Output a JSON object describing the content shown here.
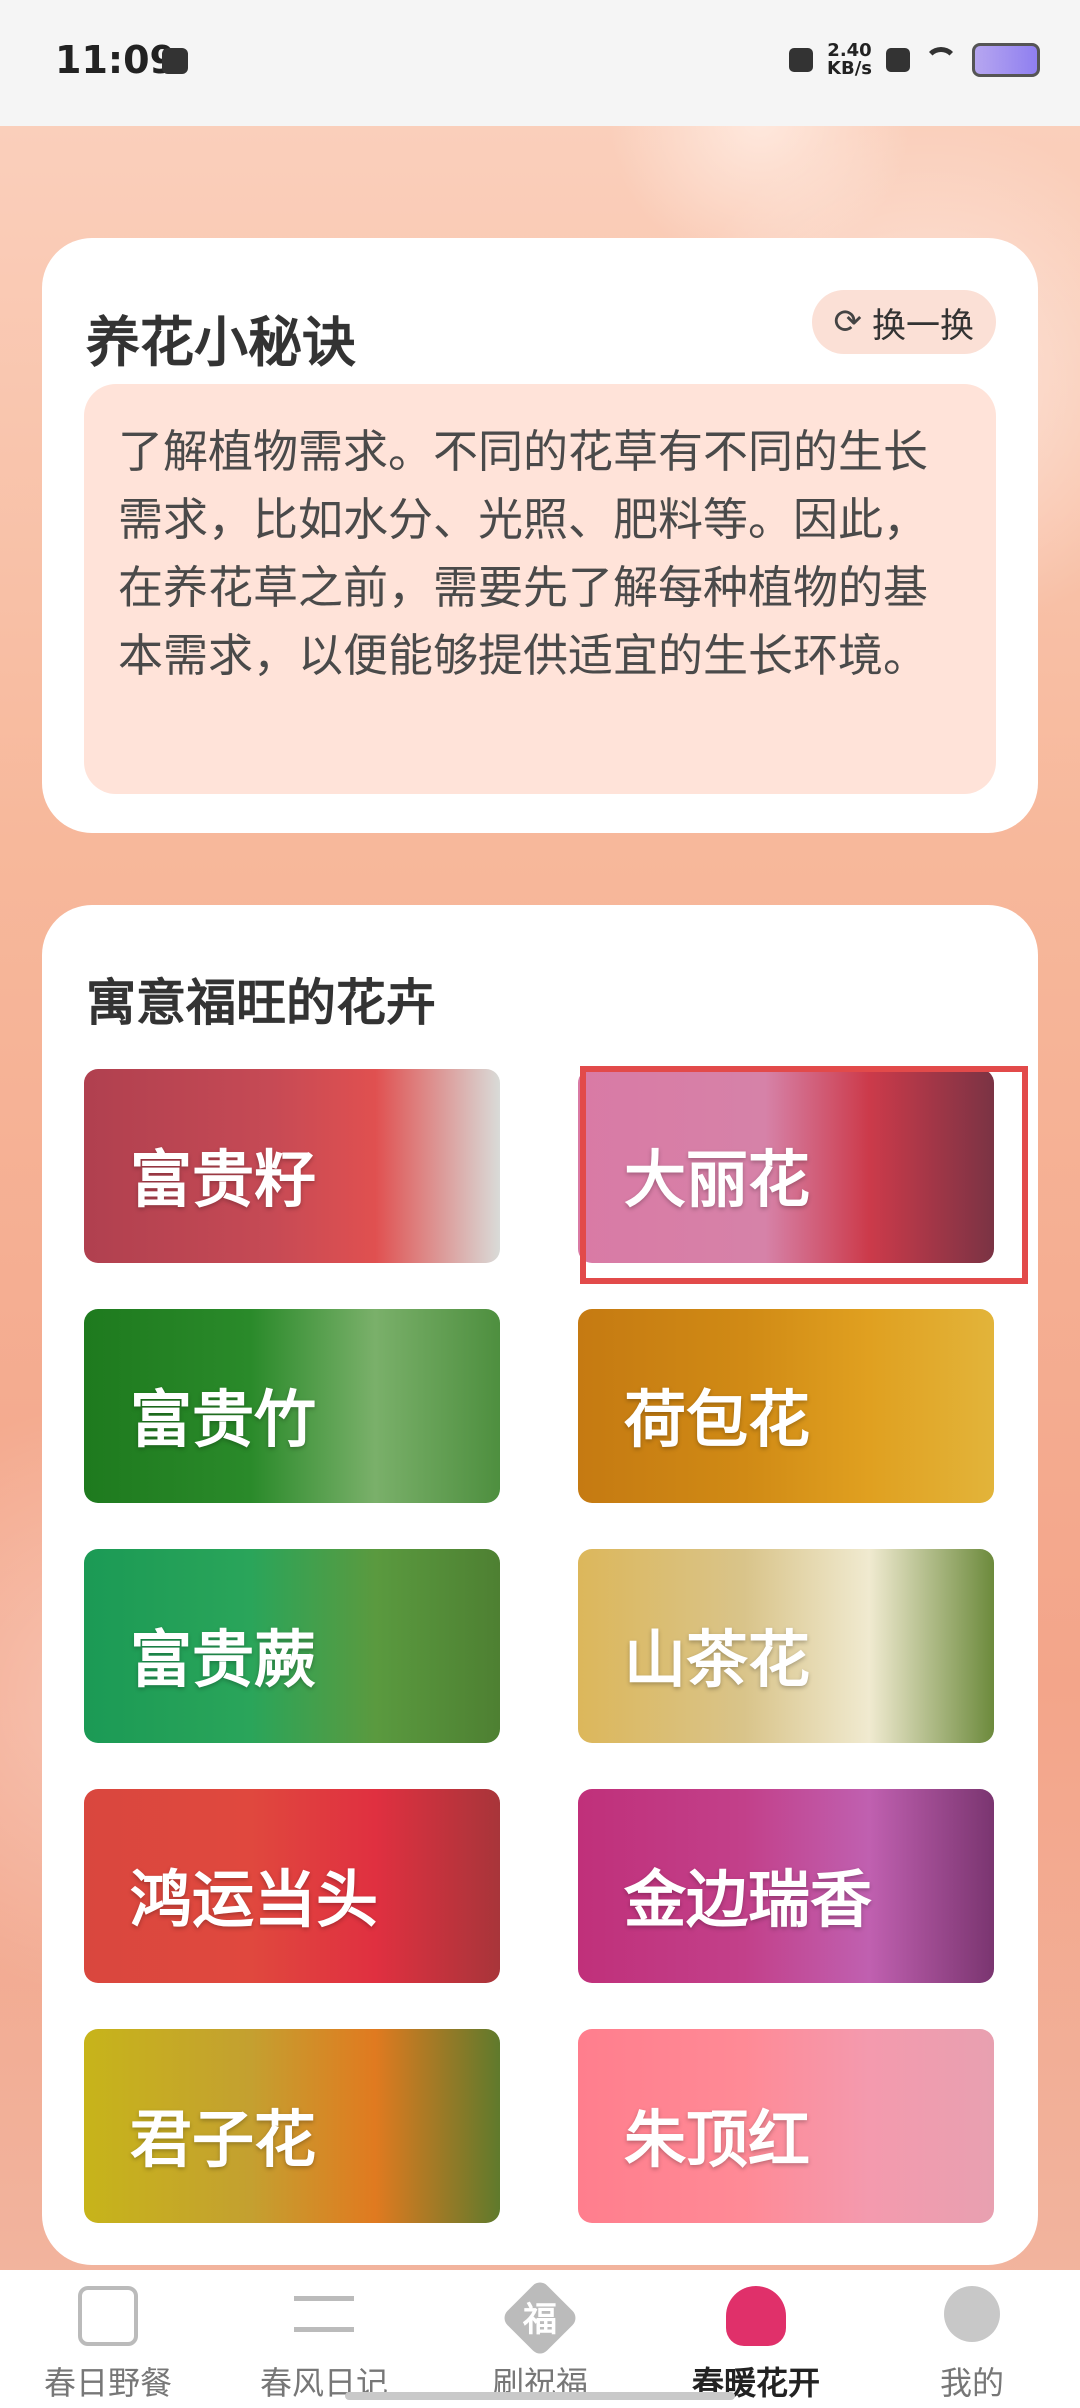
{
  "statusbar": {
    "time": "11:09",
    "network_speed": "2.40",
    "network_unit": "KB/s",
    "icons": [
      "mail-icon",
      "mute-icon",
      "close-box-icon",
      "wifi-icon",
      "battery-icon"
    ]
  },
  "tips": {
    "title": "养花小秘诀",
    "swap_label": "换一换",
    "swap_icon": "refresh-icon",
    "text": "了解植物需求。不同的花草有不同的生长需求，比如水分、光照、肥料等。因此，在养花草之前，需要先了解每种植物的基本需求，以便能够提供适宜的生长环境。"
  },
  "flowers": {
    "title": "寓意福旺的花卉",
    "items": [
      {
        "label": "富贵籽"
      },
      {
        "label": "大丽花"
      },
      {
        "label": "富贵竹"
      },
      {
        "label": "荷包花"
      },
      {
        "label": "富贵蕨"
      },
      {
        "label": "山茶花"
      },
      {
        "label": "鸿运当头"
      },
      {
        "label": "金边瑞香"
      },
      {
        "label": "君子花"
      },
      {
        "label": "朱顶红"
      }
    ]
  },
  "nav": {
    "items": [
      {
        "label": "春日野餐",
        "icon": "basket-icon"
      },
      {
        "label": "春风日记",
        "icon": "wind-icon"
      },
      {
        "label": "刷祝福",
        "icon": "fu-icon",
        "icon_text": "福"
      },
      {
        "label": "春暖花开",
        "icon": "tulip-icon"
      },
      {
        "label": "我的",
        "icon": "person-icon"
      }
    ],
    "active_index": 3
  },
  "colors": {
    "accent": "#e0306a",
    "highlight": "#e24a4a",
    "tips_bg": "#ffe3d9"
  }
}
